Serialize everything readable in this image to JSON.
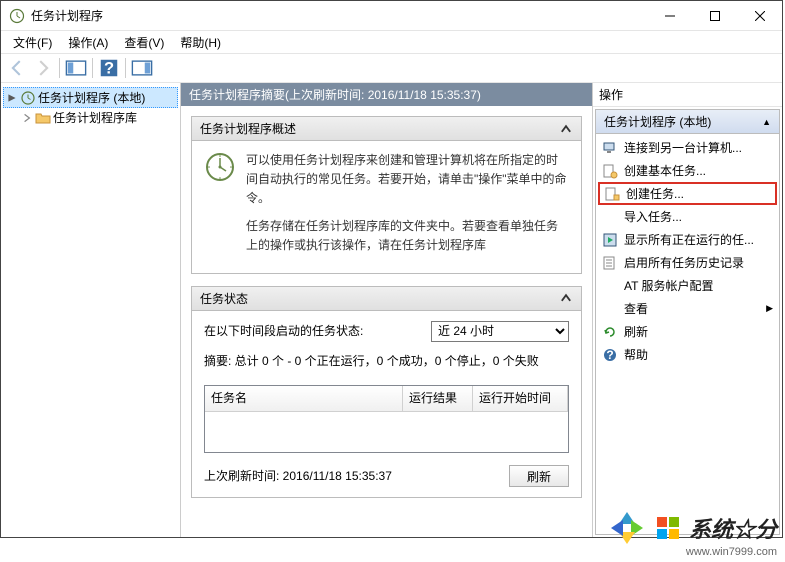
{
  "window": {
    "title": "任务计划程序"
  },
  "menu": {
    "file": "文件(F)",
    "action": "操作(A)",
    "view": "查看(V)",
    "help": "帮助(H)"
  },
  "tree": {
    "root": "任务计划程序 (本地)",
    "library": "任务计划程序库"
  },
  "center": {
    "header_label": "任务计划程序摘要(上次刷新时间:",
    "header_time": "2016/11/18 15:35:37)",
    "overview_title": "任务计划程序概述",
    "overview_p1": "可以使用任务计划程序来创建和管理计算机将在所指定的时间自动执行的常见任务。若要开始，请单击\"操作\"菜单中的命令。",
    "overview_p2": "任务存储在任务计划程序库的文件夹中。若要查看单独任务上的操作或执行该操作，请在任务计划程序库",
    "status_title": "任务状态",
    "status_label": "在以下时间段启动的任务状态:",
    "status_period_selected": "近 24 小时",
    "summary_label": "摘要: 总计 0 个 - 0 个正在运行，0 个成功，0 个停止，0 个失败",
    "table": {
      "col1": "任务名",
      "col2": "运行结果",
      "col3": "运行开始时间"
    },
    "bottom_label": "上次刷新时间: 2016/11/18 15:35:37",
    "refresh_btn": "刷新"
  },
  "actions": {
    "panel_title": "操作",
    "group_title": "任务计划程序 (本地)",
    "items": [
      {
        "label": "连接到另一台计算机..."
      },
      {
        "label": "创建基本任务..."
      },
      {
        "label": "创建任务..."
      },
      {
        "label": "导入任务..."
      },
      {
        "label": "显示所有正在运行的任..."
      },
      {
        "label": "启用所有任务历史记录"
      },
      {
        "label": "AT 服务帐户配置"
      },
      {
        "label": "查看"
      },
      {
        "label": "刷新"
      },
      {
        "label": "帮助"
      }
    ]
  },
  "watermark": {
    "text": "系统☆分",
    "url": "www.win7999.com"
  }
}
